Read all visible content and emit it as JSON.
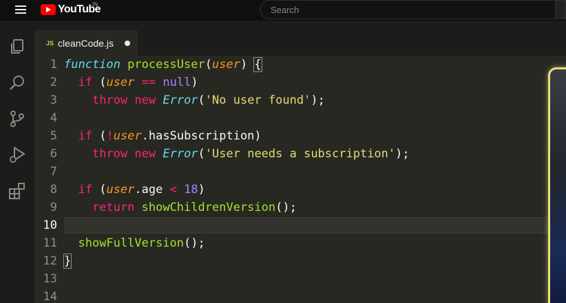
{
  "youtube": {
    "logo_text": "YouTube",
    "country_code": "IN",
    "search_placeholder": "Search"
  },
  "editor": {
    "tab": {
      "badge": "JS",
      "filename": "cleanCode.js",
      "unsaved": true
    },
    "active_line": 10,
    "lines": [
      {
        "n": "1",
        "tokens": [
          [
            "fn-kw",
            "function"
          ],
          [
            "plain",
            " "
          ],
          [
            "fn",
            "processUser"
          ],
          [
            "plain",
            "("
          ],
          [
            "param",
            "user"
          ],
          [
            "plain",
            ") "
          ],
          [
            "brace",
            "{"
          ]
        ]
      },
      {
        "n": "2",
        "tokens": [
          [
            "plain",
            "  "
          ],
          [
            "kw",
            "if"
          ],
          [
            "plain",
            " ("
          ],
          [
            "param",
            "user"
          ],
          [
            "plain",
            " "
          ],
          [
            "kw",
            "=="
          ],
          [
            "plain",
            " "
          ],
          [
            "const",
            "null"
          ],
          [
            "plain",
            ")"
          ]
        ]
      },
      {
        "n": "3",
        "tokens": [
          [
            "plain",
            "    "
          ],
          [
            "kw",
            "throw"
          ],
          [
            "plain",
            " "
          ],
          [
            "kw",
            "new"
          ],
          [
            "plain",
            " "
          ],
          [
            "cls",
            "Error"
          ],
          [
            "plain",
            "("
          ],
          [
            "str",
            "'No user found'"
          ],
          [
            "plain",
            ");"
          ]
        ]
      },
      {
        "n": "4",
        "tokens": []
      },
      {
        "n": "5",
        "tokens": [
          [
            "plain",
            "  "
          ],
          [
            "kw",
            "if"
          ],
          [
            "plain",
            " ("
          ],
          [
            "kw",
            "!"
          ],
          [
            "param",
            "user"
          ],
          [
            "plain",
            ".hasSubscription)"
          ]
        ]
      },
      {
        "n": "6",
        "tokens": [
          [
            "plain",
            "    "
          ],
          [
            "kw",
            "throw"
          ],
          [
            "plain",
            " "
          ],
          [
            "kw",
            "new"
          ],
          [
            "plain",
            " "
          ],
          [
            "cls",
            "Error"
          ],
          [
            "plain",
            "("
          ],
          [
            "str",
            "'User needs a subscription'"
          ],
          [
            "plain",
            ");"
          ]
        ]
      },
      {
        "n": "7",
        "tokens": []
      },
      {
        "n": "8",
        "tokens": [
          [
            "plain",
            "  "
          ],
          [
            "kw",
            "if"
          ],
          [
            "plain",
            " ("
          ],
          [
            "param",
            "user"
          ],
          [
            "plain",
            ".age "
          ],
          [
            "kw",
            "<"
          ],
          [
            "plain",
            " "
          ],
          [
            "const",
            "18"
          ],
          [
            "plain",
            ")"
          ]
        ]
      },
      {
        "n": "9",
        "tokens": [
          [
            "plain",
            "    "
          ],
          [
            "kw",
            "return"
          ],
          [
            "plain",
            " "
          ],
          [
            "fn",
            "showChildrenVersion"
          ],
          [
            "plain",
            "();"
          ]
        ]
      },
      {
        "n": "10",
        "tokens": []
      },
      {
        "n": "11",
        "tokens": [
          [
            "plain",
            "  "
          ],
          [
            "fn",
            "showFullVersion"
          ],
          [
            "plain",
            "();"
          ]
        ]
      },
      {
        "n": "12",
        "tokens": [
          [
            "brace",
            "}"
          ]
        ]
      },
      {
        "n": "13",
        "tokens": []
      },
      {
        "n": "14",
        "tokens": []
      }
    ]
  },
  "icons": {
    "activity_bar": [
      "explorer-icon",
      "search-icon",
      "source-control-icon",
      "run-debug-icon",
      "extensions-icon"
    ]
  },
  "colors": {
    "youtube_red": "#ff0000",
    "editor_bg": "#272822",
    "keyword": "#f92672",
    "function": "#a6e22e",
    "string": "#e6db74",
    "parameter": "#fd971f",
    "constant": "#ae81ff",
    "webcam_border": "#e9e07a"
  }
}
